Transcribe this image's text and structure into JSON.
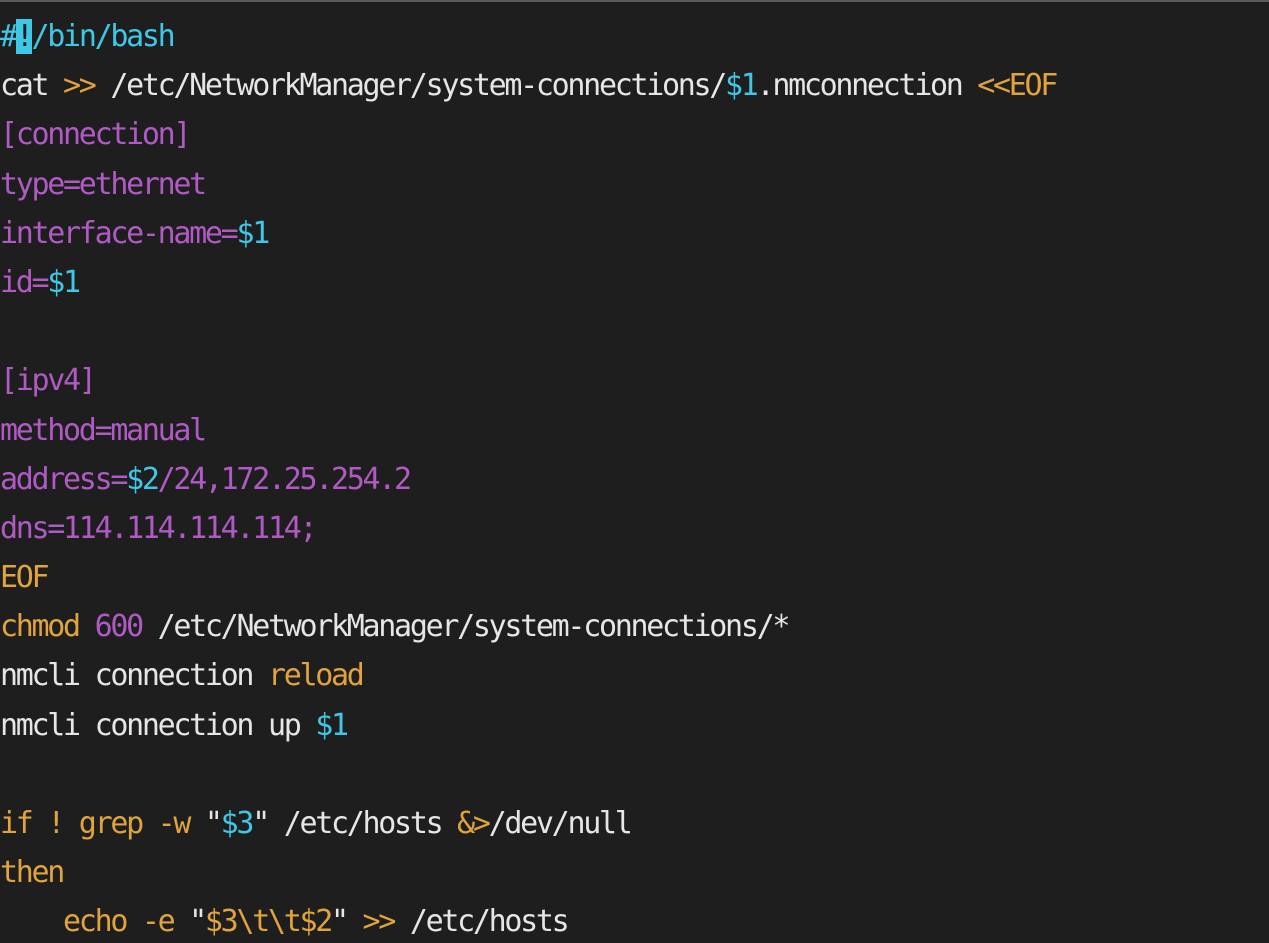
{
  "colors": {
    "background": "#1e1e1e",
    "default": "#e6e6e6",
    "comment": "#3fc7e6",
    "keyword": "#e1a43c",
    "heredoc": "#b05ac4",
    "variable": "#3fc7e6",
    "number": "#b05ac4",
    "cursor": "#3fc7e6"
  },
  "editor": {
    "lines": [
      [
        {
          "text": "#",
          "color": "#3fc7e6"
        },
        {
          "text": "!",
          "color": "#1e1e1e",
          "cursor": true
        },
        {
          "text": "/bin/bash",
          "color": "#3fc7e6"
        }
      ],
      [
        {
          "text": "cat ",
          "color": "#e6e6e6"
        },
        {
          "text": ">>",
          "color": "#e1a43c"
        },
        {
          "text": " /etc/NetworkManager/system-connections/",
          "color": "#e6e6e6"
        },
        {
          "text": "$1",
          "color": "#3fc7e6"
        },
        {
          "text": ".nmconnection ",
          "color": "#e6e6e6"
        },
        {
          "text": "<<EOF",
          "color": "#e1a43c"
        }
      ],
      [
        {
          "text": "[connection]",
          "color": "#b05ac4"
        }
      ],
      [
        {
          "text": "type=ethernet",
          "color": "#b05ac4"
        }
      ],
      [
        {
          "text": "interface-name=",
          "color": "#b05ac4"
        },
        {
          "text": "$1",
          "color": "#3fc7e6"
        }
      ],
      [
        {
          "text": "id=",
          "color": "#b05ac4"
        },
        {
          "text": "$1",
          "color": "#3fc7e6"
        }
      ],
      [],
      [
        {
          "text": "[ipv4]",
          "color": "#b05ac4"
        }
      ],
      [
        {
          "text": "method=manual",
          "color": "#b05ac4"
        }
      ],
      [
        {
          "text": "address=",
          "color": "#b05ac4"
        },
        {
          "text": "$2",
          "color": "#3fc7e6"
        },
        {
          "text": "/24,172.25.254.2",
          "color": "#b05ac4"
        }
      ],
      [
        {
          "text": "dns=114.114.114.114;",
          "color": "#b05ac4"
        }
      ],
      [
        {
          "text": "EOF",
          "color": "#e1a43c"
        }
      ],
      [
        {
          "text": "chmod",
          "color": "#e1a43c"
        },
        {
          "text": " ",
          "color": "#e6e6e6"
        },
        {
          "text": "600",
          "color": "#b05ac4"
        },
        {
          "text": " /etc/NetworkManager/system-connections/*",
          "color": "#e6e6e6"
        }
      ],
      [
        {
          "text": "nmcli connection ",
          "color": "#e6e6e6"
        },
        {
          "text": "reload",
          "color": "#e1a43c"
        }
      ],
      [
        {
          "text": "nmcli connection up ",
          "color": "#e6e6e6"
        },
        {
          "text": "$1",
          "color": "#3fc7e6"
        }
      ],
      [],
      [
        {
          "text": "if ! grep -w ",
          "color": "#e1a43c"
        },
        {
          "text": "\"",
          "color": "#e6e6e6"
        },
        {
          "text": "$3",
          "color": "#3fc7e6"
        },
        {
          "text": "\"",
          "color": "#e6e6e6"
        },
        {
          "text": " /etc/hosts ",
          "color": "#e6e6e6"
        },
        {
          "text": "&>",
          "color": "#e1a43c"
        },
        {
          "text": "/dev/null",
          "color": "#e6e6e6"
        }
      ],
      [
        {
          "text": "then",
          "color": "#e1a43c"
        }
      ],
      [
        {
          "text": "    echo -e ",
          "color": "#e1a43c"
        },
        {
          "text": "\"",
          "color": "#e6e6e6"
        },
        {
          "text": "$3\\t\\t$2",
          "color": "#e1a43c"
        },
        {
          "text": "\"",
          "color": "#e6e6e6"
        },
        {
          "text": " ",
          "color": "#e6e6e6"
        },
        {
          "text": ">>",
          "color": "#e1a43c"
        },
        {
          "text": " /etc/hosts",
          "color": "#e6e6e6"
        }
      ]
    ]
  }
}
